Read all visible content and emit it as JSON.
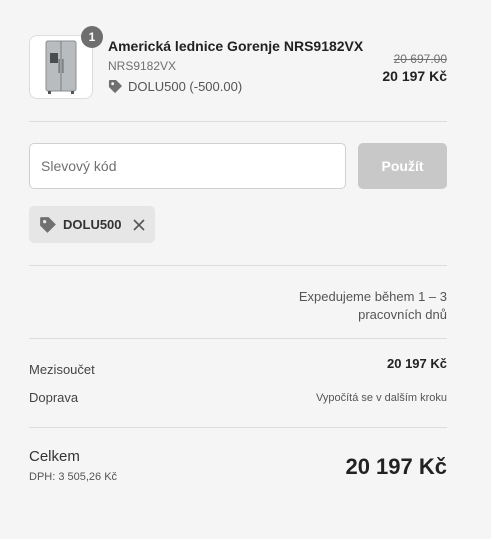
{
  "product": {
    "quantity": "1",
    "name": "Americká lednice Gorenje NRS9182VX",
    "sku": "NRS9182VX",
    "discount_applied": "DOLU500 (-500.00)",
    "original_price": "20 697.00",
    "price": "20 197 Kč",
    "image_icon": "refrigerator-image"
  },
  "discount": {
    "placeholder": "Slevový kód",
    "apply_label": "Použít",
    "applied_code": "DOLU500",
    "tag_icon": "tag-icon",
    "remove_icon": "close-icon"
  },
  "shipping": {
    "info": "Expedujeme během 1 – 3 pracovních dnů"
  },
  "totals": {
    "subtotal_label": "Mezisoučet",
    "subtotal_value": "20 197 Kč",
    "shipping_label": "Doprava",
    "shipping_value": "Vypočítá se v dalším kroku",
    "total_label": "Celkem",
    "tax_label": "DPH: 3 505,26 Kč",
    "total_value": "20 197 Kč"
  },
  "colors": {
    "background": "#f5f5f5",
    "apply_button_disabled": "#c8c8c8",
    "badge": "#6e6e6e",
    "tag_background": "#e6e6e6"
  }
}
